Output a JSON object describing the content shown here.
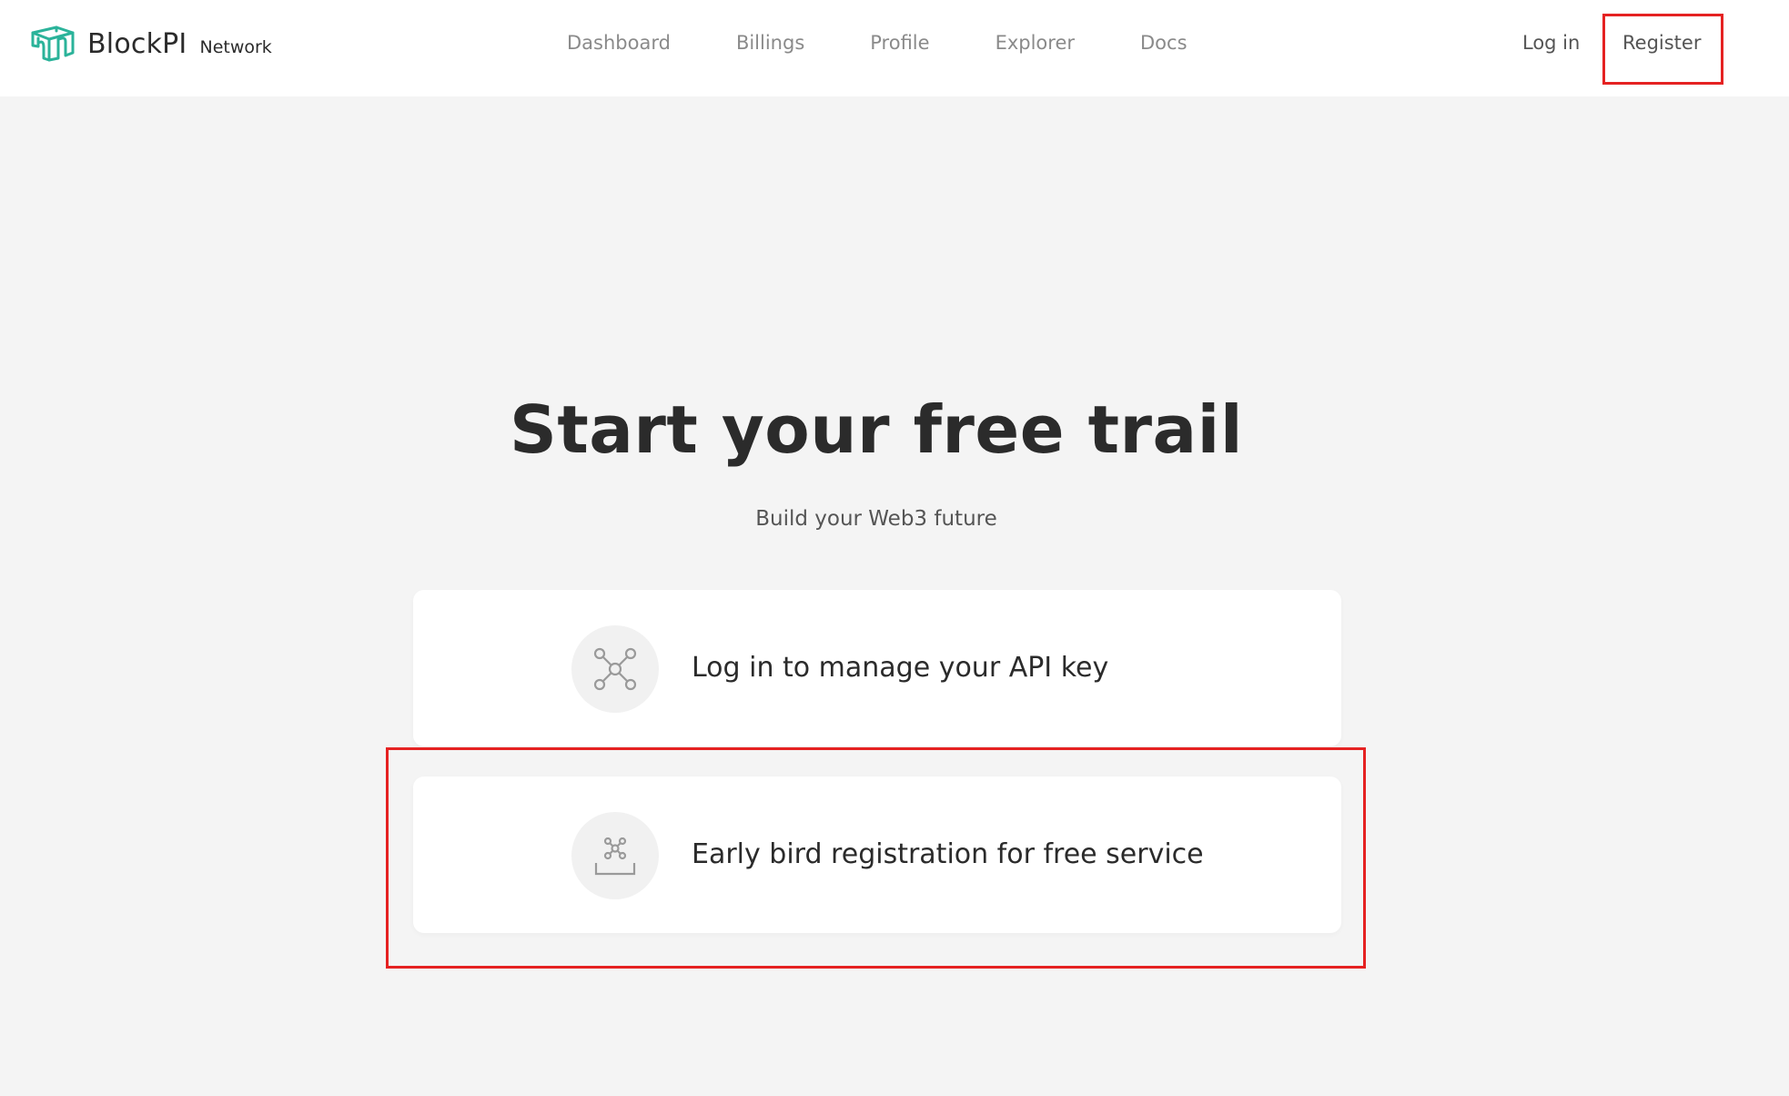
{
  "brand": {
    "name": "BlockPI",
    "sub": "Network",
    "color": "#2bb39a"
  },
  "nav": {
    "items": [
      {
        "label": "Dashboard"
      },
      {
        "label": "Billings"
      },
      {
        "label": "Profile"
      },
      {
        "label": "Explorer"
      },
      {
        "label": "Docs"
      }
    ]
  },
  "auth": {
    "login_label": "Log in",
    "register_label": "Register"
  },
  "hero": {
    "title": "Start your free trail",
    "subtitle": "Build your Web3 future"
  },
  "cards": [
    {
      "label": "Log in to manage your API key",
      "icon": "network-nodes-icon"
    },
    {
      "label": "Early bird registration for free service",
      "icon": "inbox-nodes-icon"
    }
  ],
  "colors": {
    "highlight": "#e52222",
    "background": "#f4f4f4",
    "header": "#ffffff"
  }
}
